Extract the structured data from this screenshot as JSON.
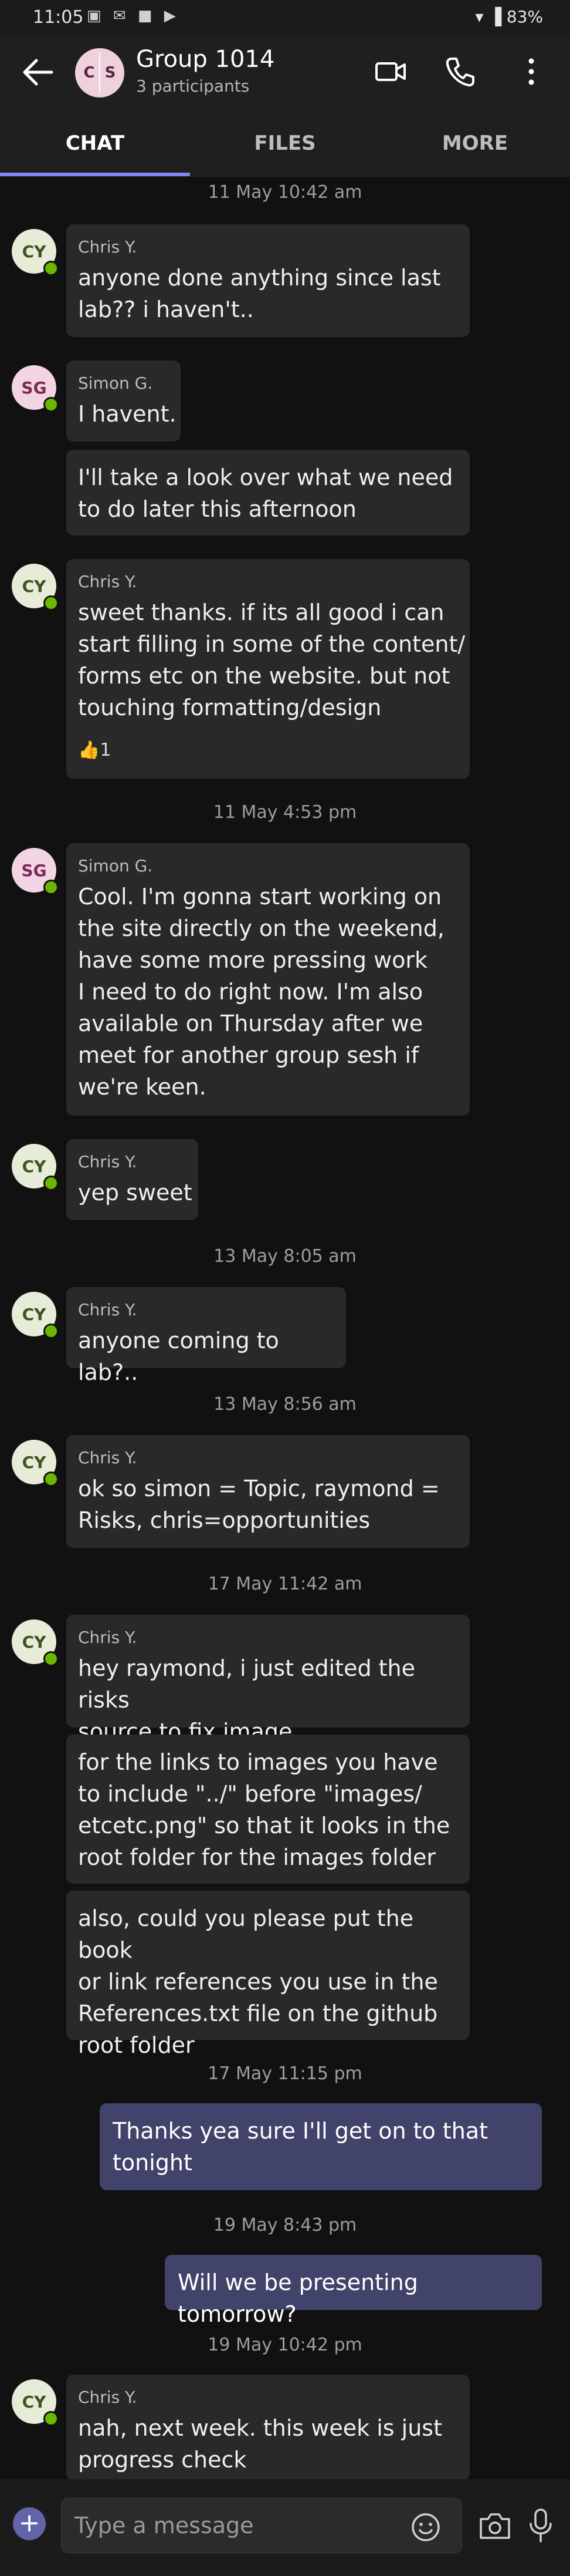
{
  "status_bar": {
    "time": "11:05",
    "notifications": "▣ ✉ ■ ▶",
    "battery": "83%",
    "signal": "▾ ▐"
  },
  "header": {
    "title": "Group 1014",
    "subtitle": "3 participants",
    "avatar_left": "C",
    "avatar_right": "S"
  },
  "tabs": [
    {
      "label": "CHAT",
      "active": true
    },
    {
      "label": "FILES",
      "active": false
    },
    {
      "label": "MORE",
      "active": false
    }
  ],
  "timestamps": [
    "11 May 10:42 am",
    "11 May 4:53 pm",
    "13 May 8:05 am",
    "13 May 8:56 am",
    "17 May 11:42 am",
    "17 May 11:15 pm",
    "19 May 8:43 pm",
    "19 May 10:42 pm"
  ],
  "avatars": {
    "cy": "CY",
    "sg": "SG"
  },
  "messages": [
    {
      "sender": "Chris Y.",
      "text": "anyone done anything since last\nlab?? i haven't.."
    },
    {
      "sender": "Simon G.",
      "text": "I havent."
    },
    {
      "text": "I'll take a look over what we need\nto do later this afternoon"
    },
    {
      "sender": "Chris Y.",
      "text": "sweet thanks. if its all good i can\nstart filling in some of the content/\nforms etc on the website. but not\ntouching formatting/design",
      "reaction": "👍1"
    },
    {
      "sender": "Simon G.",
      "text": "Cool. I'm gonna start working on\nthe site directly on the weekend,\nhave some more pressing work\nI need to do right now. I'm also\navailable on Thursday after we\nmeet for another group sesh if\nwe're keen."
    },
    {
      "sender": "Chris Y.",
      "text": "yep sweet"
    },
    {
      "sender": "Chris Y.",
      "text": "anyone coming to lab?.."
    },
    {
      "sender": "Chris Y.",
      "text": "ok so simon = Topic, raymond =\nRisks, chris=opportunities"
    },
    {
      "sender": "Chris Y.",
      "text": "hey raymond, i just edited the risks\nsource to fix image"
    },
    {
      "text": "for the links to images you have\nto include \"../\" before \"images/\netcetc.png\" so that it looks in the\nroot folder for the images folder"
    },
    {
      "text": "also, could you please put the book\nor link references you use in the\nReferences.txt file on the github\nroot folder"
    },
    {
      "text": "Thanks yea sure I'll get on to that\ntonight"
    },
    {
      "text": "Will we be presenting tomorrow?"
    },
    {
      "sender": "Chris Y.",
      "text": "nah, next week. this week is just\nprogress check"
    }
  ],
  "composer": {
    "placeholder": "Type a message",
    "add_label": "+"
  },
  "colors": {
    "accent": "#7f85f5",
    "outgoing_bubble": "#42436a",
    "incoming_bubble": "#292929",
    "presence": "#6bb700"
  }
}
